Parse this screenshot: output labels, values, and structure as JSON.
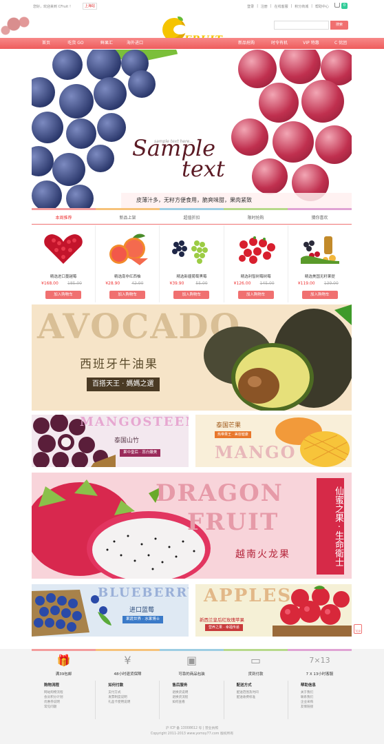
{
  "topbar": {
    "welcome": "您好，欢迎来到 CFruit ！",
    "region": "上海站",
    "links": [
      "登录",
      "注册",
      "在线客服",
      "积分商城",
      "帮助中心"
    ],
    "cart_count": "0"
  },
  "header": {
    "logo_text": "FRUIT",
    "search_placeholder": "",
    "search_button": "搜索"
  },
  "nav": [
    "首页",
    "吃货 GO",
    "鲜果汇",
    "海外进口",
    "新品抢购",
    "时令有机",
    "VIP 特惠",
    "C 优团"
  ],
  "hero": {
    "small_text": "sample text here...",
    "title_line1": "Sample",
    "title_line2": "text",
    "slogan": "皮薄汁多，无籽方便食用，脆爽味甜，果肉紧致"
  },
  "tabs": [
    "本周推荐",
    "新品上架",
    "超值折扣",
    "限时抢购",
    "猜你喜欢"
  ],
  "products": [
    {
      "name": "精选进口蔓越莓",
      "price": "¥168.00",
      "old": "185.00",
      "button": "加入购物车"
    },
    {
      "name": "精选南非红西柚",
      "price": "¥28.90",
      "old": "42.90",
      "button": "加入购物车"
    },
    {
      "name": "精选新疆葡萄黑莓",
      "price": "¥39.90",
      "old": "55.00",
      "button": "加入购物车"
    },
    {
      "name": "精选利智树莓树莓",
      "price": "¥126.00",
      "old": "145.00",
      "button": "加入购物车"
    },
    {
      "name": "精选美国无籽果提",
      "price": "¥119.00",
      "old": "139.00",
      "button": "加入购物车"
    }
  ],
  "banners": {
    "avocado": {
      "big": "AVOCADO",
      "cn": "西班牙牛油果",
      "tag": "百搭天王 · 媽媽之選"
    },
    "mangosteen": {
      "big": "MANGOSTEEN",
      "cn": "泰国山竹",
      "tag": "果中皇后 · 蕊白嫩美"
    },
    "mango": {
      "big": "MANGO",
      "cn": "泰国芒果",
      "tag": "热带果王 · 美容健康"
    },
    "dragon": {
      "big1": "DRAGON",
      "big2": "FRUIT",
      "cn": "越南火龙果",
      "vertical": "仙蜜之果 · 生命衛士"
    },
    "blueberry": {
      "big": "BLUEBERRY",
      "cn": "进口蓝莓",
      "tag": "果蔬世界 · 水果博士"
    },
    "apple": {
      "big": "APPLES",
      "cn": "新西兰皇后红玫瑰苹果",
      "tag": "营养之果 · 幸福传递"
    }
  },
  "back_top": "TOP",
  "services": [
    "满39包邮",
    "48小时退货保障",
    "可靠的商品包装",
    "货到付款",
    "7 X 13小时客服"
  ],
  "service_icons": [
    "gift-icon",
    "wallet-icon",
    "box-icon",
    "card-icon",
    "clock-icon"
  ],
  "service_glyphs": [
    "🎁",
    "¥",
    "▣",
    "▭",
    "7×13"
  ],
  "footer_cols": [
    {
      "title": "购物流程",
      "items": [
        "网站购物流程",
        "会员积分计划",
        "优惠券说明",
        "常见问题"
      ]
    },
    {
      "title": "如何付款",
      "items": [
        "支付方式",
        "发票制度说明",
        "礼品卡使用说明"
      ]
    },
    {
      "title": "售后服务",
      "items": [
        "退换货说明",
        "退换货流程",
        "如何查看"
      ]
    },
    {
      "title": "配送方式",
      "items": [
        "配送范围及时间",
        "配送收费标准"
      ]
    },
    {
      "title": "帮助信息",
      "items": [
        "关于我们",
        "联系我们",
        "企业采购",
        "友情链接"
      ]
    }
  ],
  "copyright": [
    "沪 ICP 备 13008612 号 | 营业执照",
    "Copyright 2011-2013 www.yomoy77.com 版权所有"
  ],
  "colors": {
    "accent": "#f07070",
    "price": "#e33333"
  }
}
